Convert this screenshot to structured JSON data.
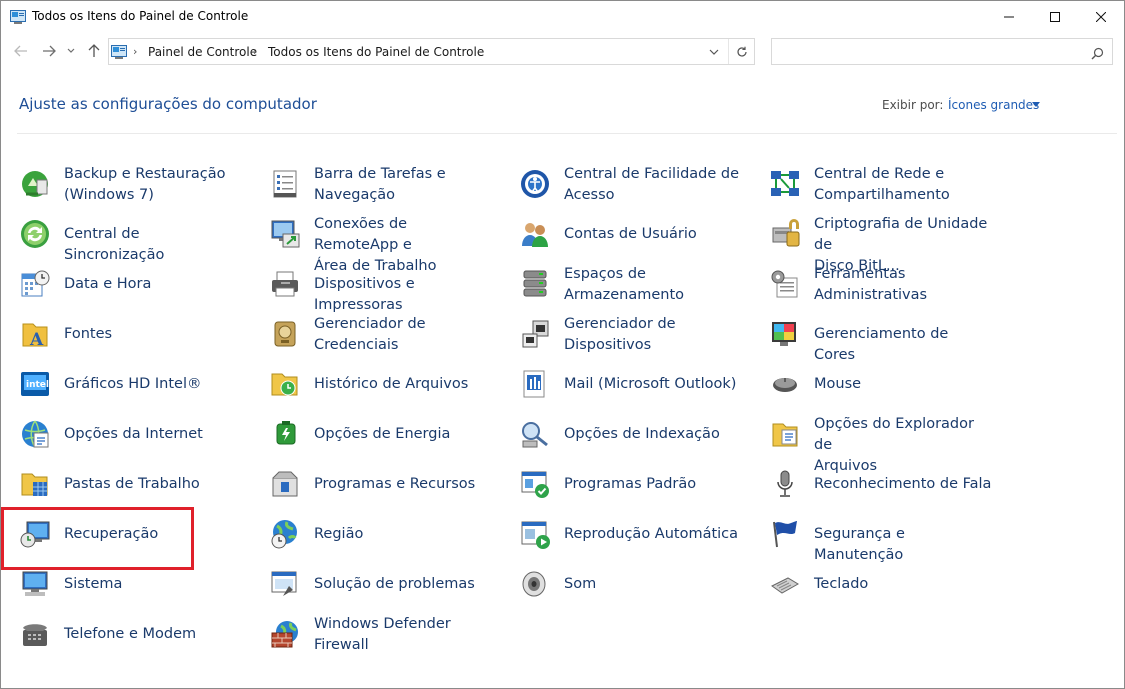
{
  "window": {
    "title": "Todos os Itens do Painel de Controle"
  },
  "address": {
    "crumbs": [
      "Painel de Controle",
      "Todos os Itens do Painel de Controle"
    ],
    "search_placeholder": ""
  },
  "header": {
    "heading": "Ajuste as configurações do computador",
    "view_by_label": "Exibir por:",
    "view_by_value": "Ícones grandes"
  },
  "items": [
    {
      "line1": "Backup e Restauração",
      "line2": "(Windows 7)",
      "icon": "backup-icon"
    },
    {
      "line1": "Barra de Tarefas e",
      "line2": "Navegação",
      "icon": "taskbar-icon"
    },
    {
      "line1": "Central de Facilidade de",
      "line2": "Acesso",
      "icon": "accessibility-icon"
    },
    {
      "line1": "Central de Rede e",
      "line2": "Compartilhamento",
      "icon": "network-icon"
    },
    {
      "line1": "Central de Sincronização",
      "line2": "",
      "icon": "sync-icon"
    },
    {
      "line1": "Conexões de RemoteApp e",
      "line2": "Área de Trabalho",
      "icon": "remoteapp-icon"
    },
    {
      "line1": "Contas de Usuário",
      "line2": "",
      "icon": "user-accounts-icon"
    },
    {
      "line1": "Criptografia de Unidade de",
      "line2": "Disco BitL...",
      "icon": "bitlocker-icon"
    },
    {
      "line1": "Data e Hora",
      "line2": "",
      "icon": "calendar-clock-icon"
    },
    {
      "line1": "Dispositivos e Impressoras",
      "line2": "",
      "icon": "printer-icon"
    },
    {
      "line1": "Espaços de",
      "line2": "Armazenamento",
      "icon": "storage-icon"
    },
    {
      "line1": "Ferramentas",
      "line2": "Administrativas",
      "icon": "admin-tools-icon"
    },
    {
      "line1": "Fontes",
      "line2": "",
      "icon": "fonts-icon"
    },
    {
      "line1": "Gerenciador de",
      "line2": "Credenciais",
      "icon": "credentials-icon"
    },
    {
      "line1": "Gerenciador de",
      "line2": "Dispositivos",
      "icon": "device-manager-icon"
    },
    {
      "line1": "Gerenciamento de Cores",
      "line2": "",
      "icon": "color-management-icon"
    },
    {
      "line1": "Gráficos HD Intel®",
      "line2": "",
      "icon": "intel-graphics-icon"
    },
    {
      "line1": "Histórico de Arquivos",
      "line2": "",
      "icon": "file-history-icon"
    },
    {
      "line1": "Mail (Microsoft Outlook)",
      "line2": "",
      "icon": "mail-icon"
    },
    {
      "line1": "Mouse",
      "line2": "",
      "icon": "mouse-icon"
    },
    {
      "line1": "Opções da Internet",
      "line2": "",
      "icon": "internet-options-icon"
    },
    {
      "line1": "Opções de Energia",
      "line2": "",
      "icon": "power-icon"
    },
    {
      "line1": "Opções de Indexação",
      "line2": "",
      "icon": "indexing-icon"
    },
    {
      "line1": "Opções do Explorador de",
      "line2": "Arquivos",
      "icon": "folder-options-icon"
    },
    {
      "line1": "Pastas de Trabalho",
      "line2": "",
      "icon": "work-folders-icon"
    },
    {
      "line1": "Programas e Recursos",
      "line2": "",
      "icon": "programs-icon"
    },
    {
      "line1": "Programas Padrão",
      "line2": "",
      "icon": "default-programs-icon"
    },
    {
      "line1": "Reconhecimento de Fala",
      "line2": "",
      "icon": "microphone-icon"
    },
    {
      "line1": "Recuperação",
      "line2": "",
      "icon": "recovery-icon"
    },
    {
      "line1": "Região",
      "line2": "",
      "icon": "region-icon"
    },
    {
      "line1": "Reprodução Automática",
      "line2": "",
      "icon": "autoplay-icon"
    },
    {
      "line1": "Segurança e Manutenção",
      "line2": "",
      "icon": "flag-icon"
    },
    {
      "line1": "Sistema",
      "line2": "",
      "icon": "system-icon"
    },
    {
      "line1": "Solução de problemas",
      "line2": "",
      "icon": "troubleshoot-icon"
    },
    {
      "line1": "Som",
      "line2": "",
      "icon": "speaker-icon"
    },
    {
      "line1": "Teclado",
      "line2": "",
      "icon": "keyboard-icon"
    },
    {
      "line1": "Telefone e Modem",
      "line2": "",
      "icon": "phone-icon"
    },
    {
      "line1": "Windows Defender",
      "line2": "Firewall",
      "icon": "firewall-icon"
    }
  ],
  "colors": {
    "link": "#1a3a6b",
    "heading": "#1e4e96",
    "highlight": "#e0202a"
  }
}
